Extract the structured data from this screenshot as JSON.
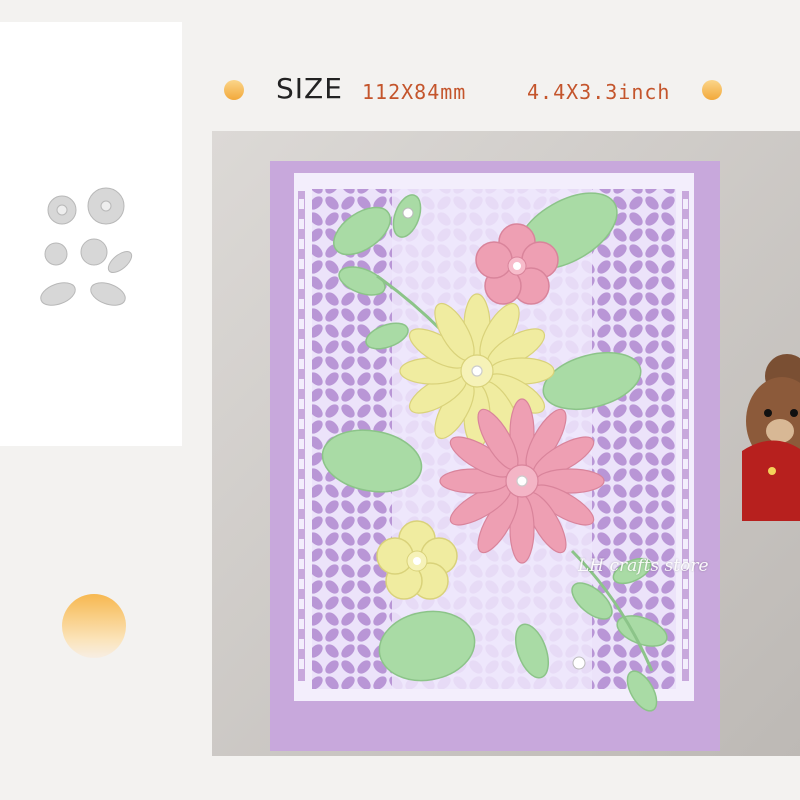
{
  "header": {
    "size_label": "SIZE",
    "size_mm": "112X84mm",
    "size_inch": "4.4X3.3inch"
  },
  "thumbnail": {
    "icon": "flower-die-thumbnail"
  },
  "photo": {
    "subject": "floral-card-photo",
    "watermark": "LH crafts store"
  },
  "colors": {
    "accent_orange": "#c4552c",
    "card_purple": "#c8a8dc",
    "panel_lilac": "#e9defa",
    "leaf_green": "#a9dba5",
    "petal_pink": "#ee9fb3",
    "petal_yellow": "#f0eca0"
  }
}
